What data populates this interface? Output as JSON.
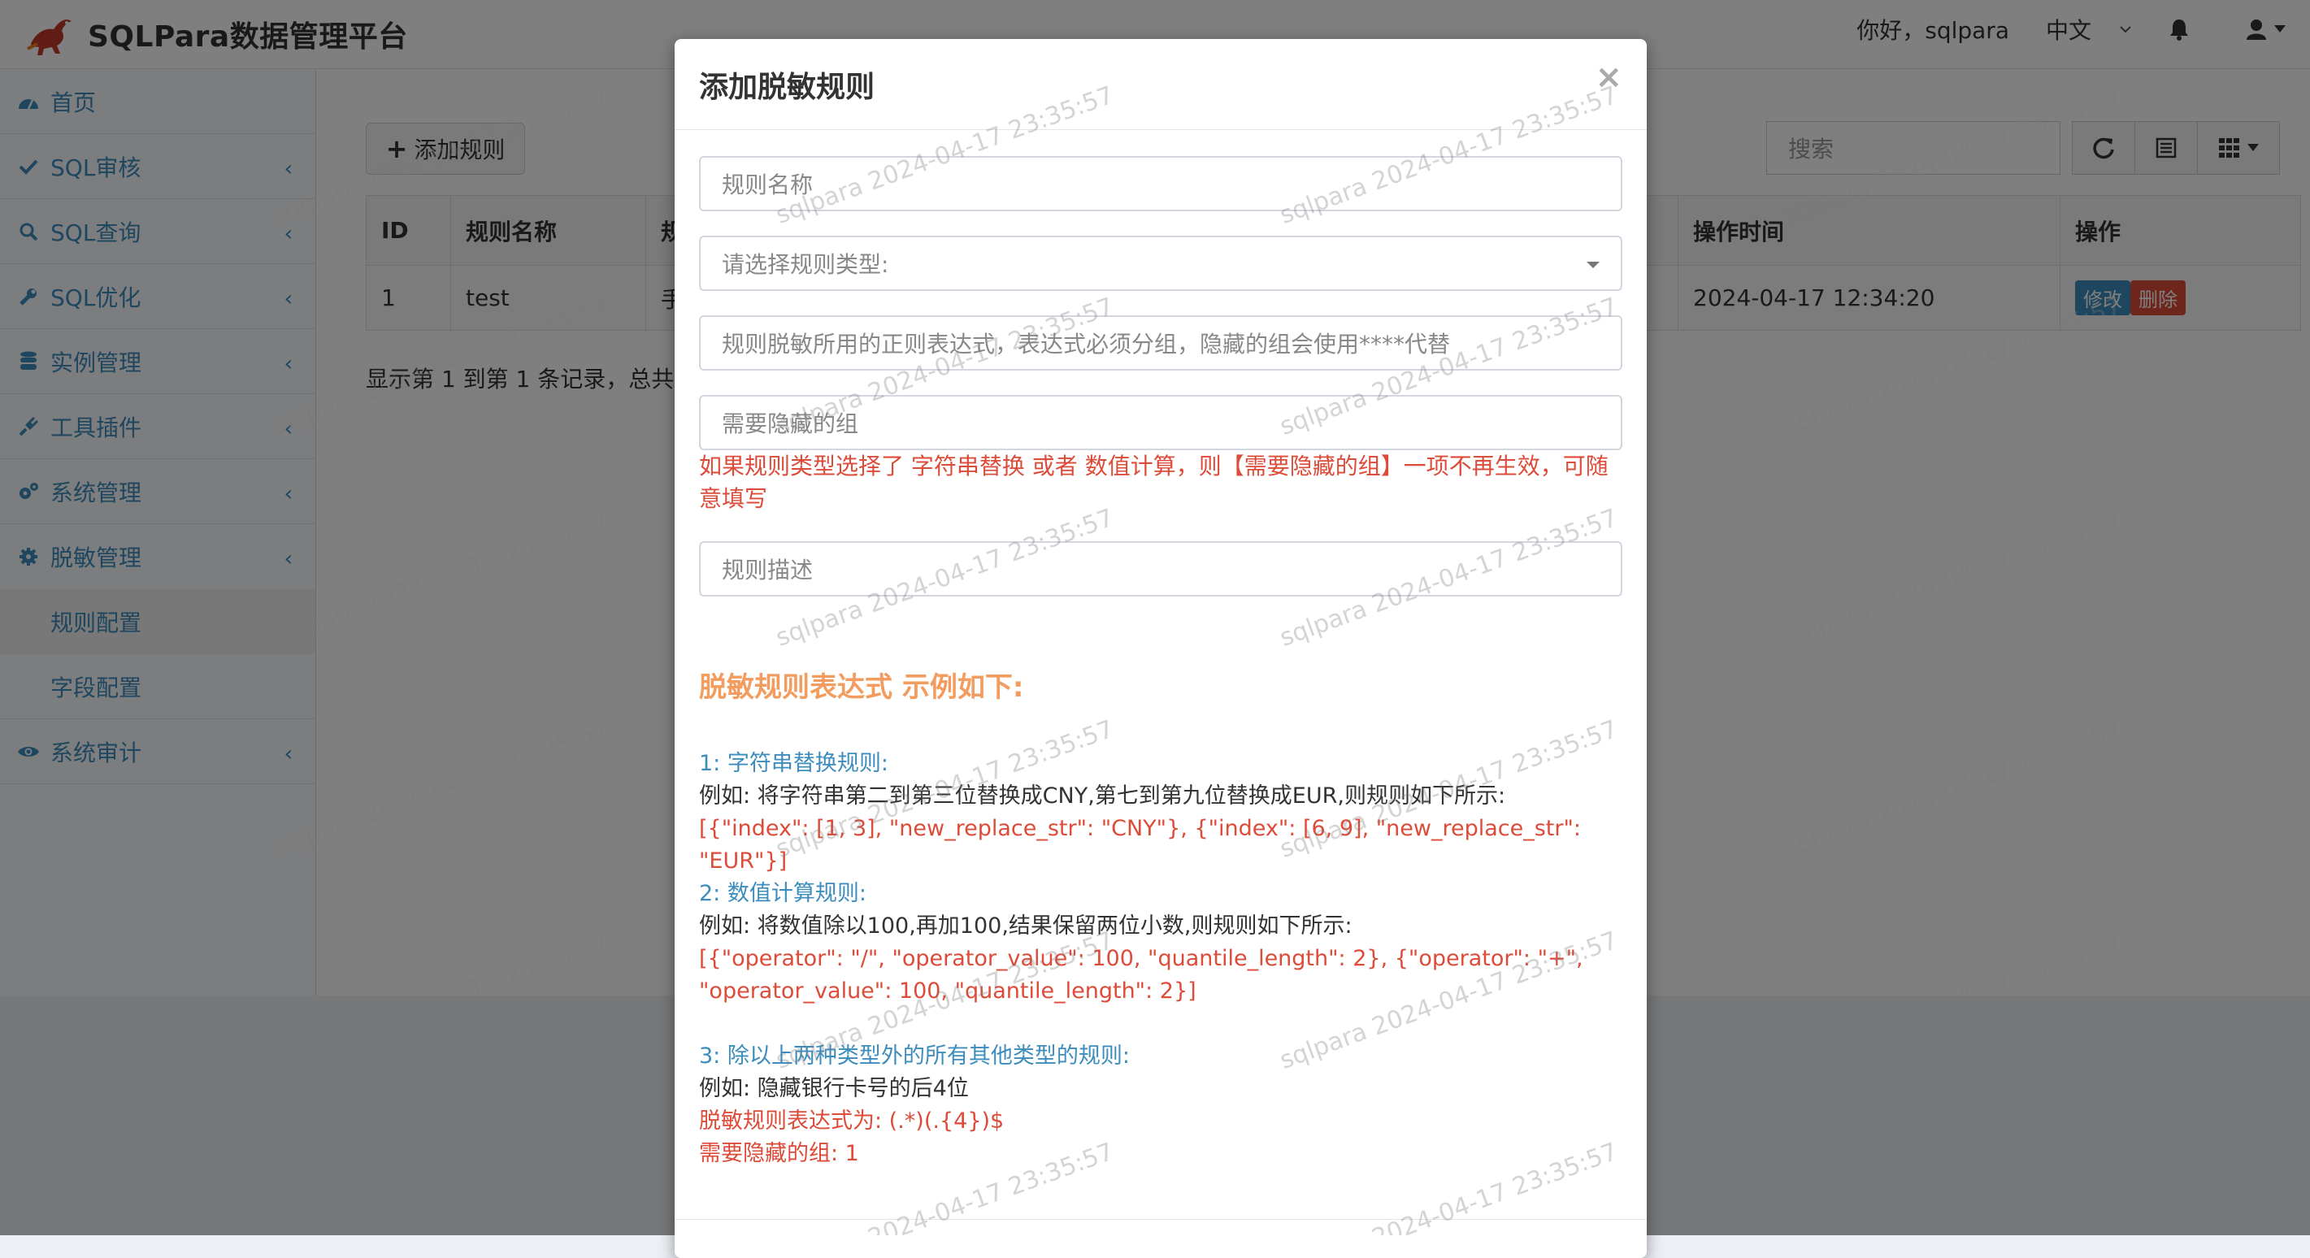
{
  "app": {
    "title": "SQLPara数据管理平台"
  },
  "header": {
    "greeting": "你好，sqlpara",
    "language": "中文"
  },
  "sidebar": {
    "items": [
      {
        "label": "首页",
        "icon": "dashboard-icon"
      },
      {
        "label": "SQL审核",
        "icon": "check-icon"
      },
      {
        "label": "SQL查询",
        "icon": "search-icon"
      },
      {
        "label": "SQL优化",
        "icon": "wrench-icon"
      },
      {
        "label": "实例管理",
        "icon": "database-icon"
      },
      {
        "label": "工具插件",
        "icon": "plug-icon"
      },
      {
        "label": "系统管理",
        "icon": "cogs-icon"
      },
      {
        "label": "脱敏管理",
        "icon": "gear-icon"
      },
      {
        "label": "系统审计",
        "icon": "eye-icon"
      }
    ],
    "subitems": [
      {
        "label": "规则配置"
      },
      {
        "label": "字段配置"
      }
    ]
  },
  "toolbar": {
    "add_label": "添加规则",
    "search_placeholder": "搜索"
  },
  "table": {
    "headers": [
      "ID",
      "规则名称",
      "规",
      "操作时间",
      "操作"
    ],
    "rows": [
      {
        "id": "1",
        "name": "test",
        "type": "手",
        "time": "2024-04-17 12:34:20",
        "edit": "修改",
        "delete": "删除"
      }
    ],
    "pager": "显示第 1 到第 1 条记录，总共"
  },
  "modal": {
    "title": "添加脱敏规则",
    "close": "×",
    "fields": {
      "rule_name": "规则名称",
      "rule_type": "请选择规则类型:",
      "regex": "规则脱敏所用的正则表达式，表达式必须分组，隐藏的组会使用****代替",
      "hidden_group": "需要隐藏的组",
      "description": "规则描述"
    },
    "hint": "如果规则类型选择了 字符串替换 或者 数值计算，则【需要隐藏的组】一项不再生效，可随意填写",
    "examples_title": "脱敏规则表达式 示例如下:",
    "ex1_title": "1: 字符串替换规则:",
    "ex1_desc": "例如: 将字符串第二到第三位替换成CNY,第七到第九位替换成EUR,则规则如下所示:",
    "ex1_code": "[{\"index\": [1, 3], \"new_replace_str\": \"CNY\"}, {\"index\": [6, 9], \"new_replace_str\": \"EUR\"}]",
    "ex2_title": "2: 数值计算规则:",
    "ex2_desc": "例如: 将数值除以100,再加100,结果保留两位小数,则规则如下所示:",
    "ex2_code1": "[{\"operator\": \"/\", \"operator_value\": 100, \"quantile_length\": 2}, {\"operator\": \"+\",",
    "ex2_code2": "\"operator_value\": 100, \"quantile_length\": 2}]",
    "ex3_title": "3: 除以上两种类型外的所有其他类型的规则:",
    "ex3_desc": "例如: 隐藏银行卡号的后4位",
    "ex3_code1": "脱敏规则表达式为: (.*)(.{4})$",
    "ex3_code2": "需要隐藏的组: 1"
  },
  "watermark": "sqlpara 2024-04-17 23:35:57",
  "colors": {
    "accent": "#3c8dbc",
    "danger": "#dd4b39",
    "example_title": "#f39c5f"
  }
}
